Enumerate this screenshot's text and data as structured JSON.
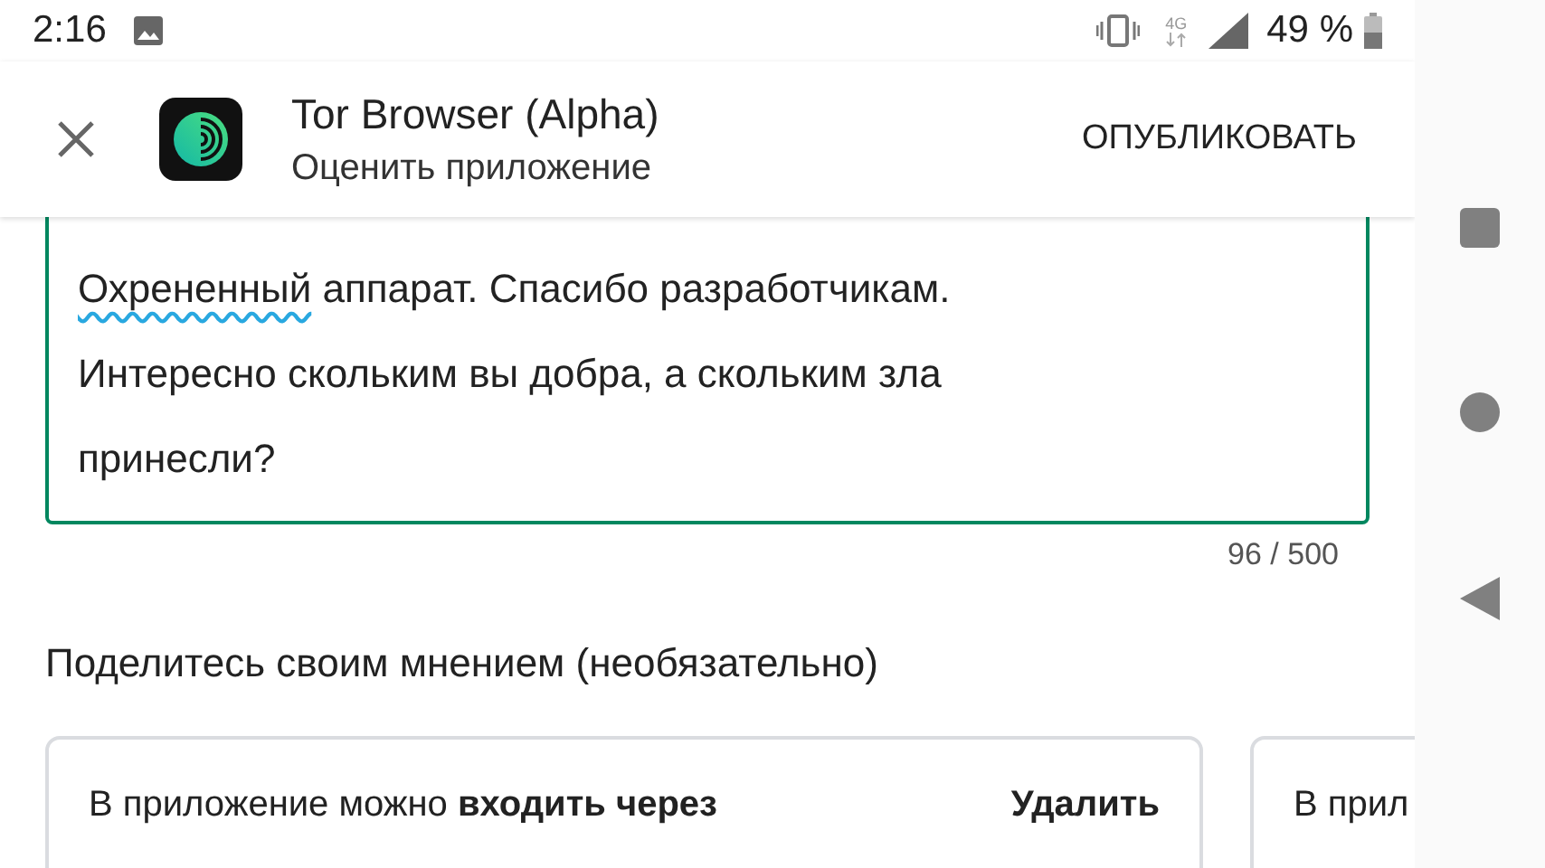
{
  "status_bar": {
    "time": "2:16",
    "network": "4G",
    "battery": "49 %"
  },
  "header": {
    "title": "Tor Browser (Alpha)",
    "subtitle": "Оценить приложение",
    "action": "ОПУБЛИКОВАТЬ"
  },
  "review": {
    "focused": true,
    "segments": [
      {
        "text": "Охрененный",
        "misspelled": true
      },
      {
        "text": " аппарат. Спасибо разработчикам. Интересно скольким вы добра, а скольким зла принесли?",
        "misspelled": false
      }
    ],
    "counter": "96 / 500"
  },
  "feedback": {
    "heading": "Поделитесь своим мнением (необязательно)",
    "cards": [
      {
        "question": "В приложение можно **входить через**",
        "action": "Удалить"
      },
      {
        "question": "В прил"
      }
    ]
  }
}
